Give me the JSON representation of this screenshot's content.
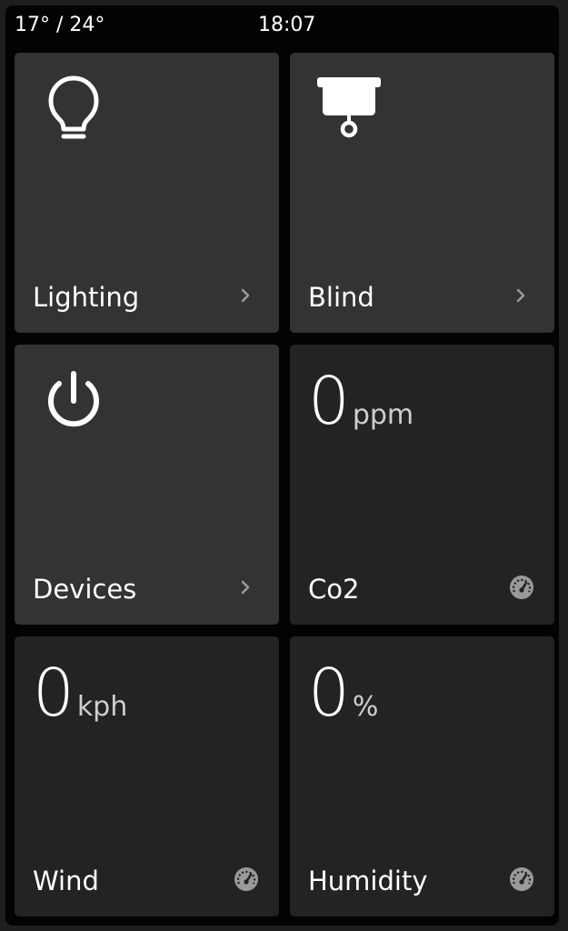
{
  "status": {
    "temperature": "17° / 24°",
    "time": "18:07"
  },
  "tiles": {
    "lighting": {
      "label": "Lighting",
      "icon": "lightbulb-icon"
    },
    "blind": {
      "label": "Blind",
      "icon": "blind-icon"
    },
    "devices": {
      "label": "Devices",
      "icon": "power-icon"
    },
    "co2": {
      "label": "Co2",
      "value": "0",
      "unit": "ppm",
      "icon": "gauge-icon"
    },
    "wind": {
      "label": "Wind",
      "value": "0",
      "unit": "kph",
      "icon": "gauge-icon"
    },
    "humidity": {
      "label": "Humidity",
      "value": "0",
      "unit": "%",
      "icon": "gauge-icon"
    }
  },
  "colors": {
    "nav_tile": "#333333",
    "sensor_tile": "#232323",
    "background": "#030303",
    "text": "#ffffff",
    "muted": "#9a9a9a"
  }
}
